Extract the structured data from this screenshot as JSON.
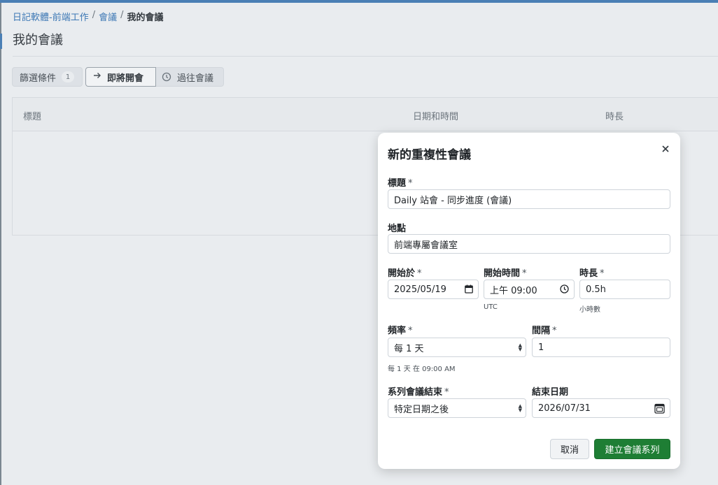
{
  "breadcrumb": {
    "items": [
      "日記軟體-前端工作",
      "會議"
    ],
    "separator": "/",
    "current": "我的會議"
  },
  "page_title": "我的會議",
  "tabs": {
    "filter_label": "篩選條件",
    "filter_count": "1",
    "upcoming_label": "即將開會",
    "past_label": "過往會議"
  },
  "table": {
    "columns": [
      "標題",
      "日期和時間",
      "時長"
    ]
  },
  "modal": {
    "title": "新的重複性會議",
    "close_icon": "close-icon",
    "required_mark": "*",
    "title_field": {
      "label": "標題",
      "value": "Daily 站會 - 同步進度 (會議)"
    },
    "location_field": {
      "label": "地點",
      "value": "前端專屬會議室"
    },
    "start_date": {
      "label": "開始於",
      "value": "2025/05/19"
    },
    "start_time": {
      "label": "開始時間",
      "value": "上午 09:00",
      "hint": "UTC"
    },
    "duration": {
      "label": "時長",
      "value": "0.5h",
      "hint": "小時數"
    },
    "frequency": {
      "label": "頻率",
      "value": "每 1 天",
      "hint": "每 1 天 在 09:00 AM"
    },
    "interval": {
      "label": "間隔",
      "value": "1"
    },
    "series_end": {
      "label": "系列會議結束",
      "value": "特定日期之後"
    },
    "end_date": {
      "label": "結束日期",
      "value": "2026/07/31"
    },
    "cancel_label": "取消",
    "create_label": "建立會議系列"
  },
  "colors": {
    "accent": "#3d78b5",
    "primary_button": "#1e7e34",
    "background": "#e9ecef"
  }
}
